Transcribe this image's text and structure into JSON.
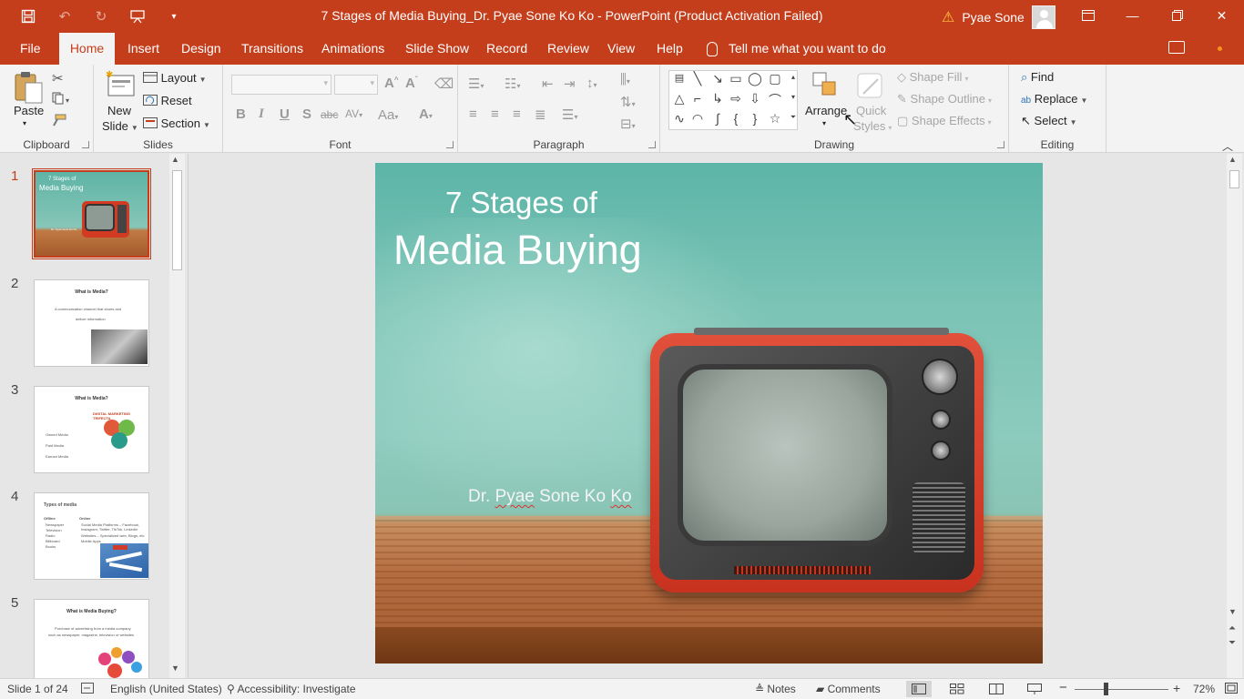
{
  "window": {
    "title": "7 Stages of Media Buying_Dr. Pyae Sone Ko Ko  -  PowerPoint (Product Activation Failed)",
    "user_name": "Pyae Sone"
  },
  "tabs": [
    "File",
    "Home",
    "Insert",
    "Design",
    "Transitions",
    "Animations",
    "Slide Show",
    "Record",
    "Review",
    "View",
    "Help"
  ],
  "active_tab": "Home",
  "tell_me": "Tell me what you want to do",
  "ribbon": {
    "clipboard": {
      "label": "Clipboard",
      "paste": "Paste"
    },
    "slides": {
      "label": "Slides",
      "new_slide_1": "New",
      "new_slide_2": "Slide",
      "layout": "Layout",
      "reset": "Reset",
      "section": "Section"
    },
    "font": {
      "label": "Font"
    },
    "paragraph": {
      "label": "Paragraph"
    },
    "drawing": {
      "label": "Drawing",
      "arrange": "Arrange",
      "quick_styles_1": "Quick",
      "quick_styles_2": "Styles",
      "shape_fill": "Shape Fill",
      "shape_outline": "Shape Outline",
      "shape_effects": "Shape Effects"
    },
    "editing": {
      "label": "Editing",
      "find": "Find",
      "replace": "Replace",
      "select": "Select"
    }
  },
  "thumbnails": [
    {
      "num": "1",
      "title1": "7 Stages of",
      "title2": "Media Buying",
      "author": "Dr. Pyae Sone Ko Ko"
    },
    {
      "num": "2",
      "title": "What is Media?",
      "body1": "A communication channel that stores and",
      "body2": "deliver information"
    },
    {
      "num": "3",
      "title": "What is Media?",
      "items": [
        "Owned Media",
        "Paid Media",
        "Earned Media"
      ],
      "graphic": "DIGITAL MARKETING TRIFECTA"
    },
    {
      "num": "4",
      "title": "Types of media",
      "col1_head": "Offline",
      "col1": [
        "Newspaper",
        "Television",
        "Radio",
        "Billboard",
        "Books"
      ],
      "col2_head": "Online",
      "col2": [
        "Social Media Platforms – Facebook, Instagram, Twitter, TikTok, LinkedIn",
        "Websites – Specialized web, Blogs, etc",
        "Mobile Apps"
      ]
    },
    {
      "num": "5",
      "title": "What is Media Buying?",
      "body1": "Purchase of advertising from a media company",
      "body2": "such as newspaper, magazine, television or websites"
    }
  ],
  "slide": {
    "title_line1": "7 Stages of",
    "title_line2": "Media Buying",
    "author_prefix": "Dr. ",
    "author_squiggle1": "Pyae",
    "author_mid": " Sone Ko ",
    "author_squiggle2": "Ko"
  },
  "status": {
    "slide_counter": "Slide 1 of 24",
    "language": "English (United States)",
    "accessibility": "Accessibility: Investigate",
    "notes": "Notes",
    "comments": "Comments",
    "zoom": "72%"
  },
  "colors": {
    "accent": "#c43e1c",
    "ribbon_bg": "#f3f3f3",
    "workspace_bg": "#e6e6e6"
  }
}
